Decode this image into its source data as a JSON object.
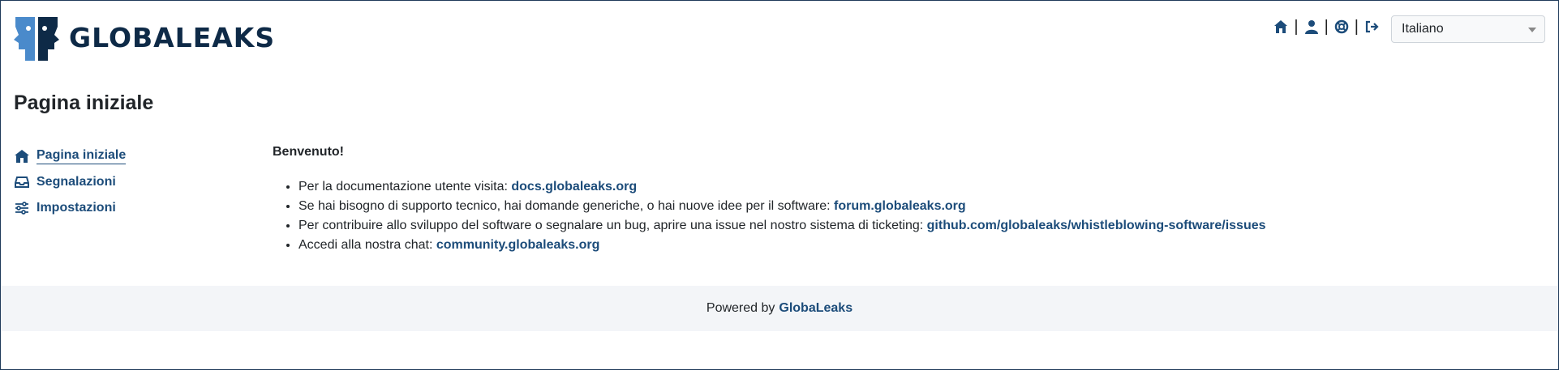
{
  "brand": {
    "name": "GLOBALEAKS",
    "logo_icon": "globaleaks-faces-logo",
    "colors": {
      "primary": "#1c4c7a",
      "dark": "#0e2a47",
      "light_blue": "#4a8acb"
    }
  },
  "header": {
    "icons": [
      "home-icon",
      "user-icon",
      "support-icon",
      "logout-icon"
    ],
    "separator": "|",
    "language": {
      "selected": "Italiano"
    }
  },
  "page": {
    "title": "Pagina iniziale"
  },
  "sidebar": {
    "items": [
      {
        "label": "Pagina iniziale",
        "icon": "home-icon",
        "active": true
      },
      {
        "label": "Segnalazioni",
        "icon": "inbox-icon",
        "active": false
      },
      {
        "label": "Impostazioni",
        "icon": "sliders-icon",
        "active": false
      }
    ]
  },
  "main": {
    "welcome": "Benvenuto!",
    "items": [
      {
        "text": "Per la documentazione utente visita: ",
        "link": "docs.globaleaks.org"
      },
      {
        "text": "Se hai bisogno di supporto tecnico, hai domande generiche, o hai nuove idee per il software: ",
        "link": "forum.globaleaks.org"
      },
      {
        "text": "Per contribuire allo sviluppo del software o segnalare un bug, aprire una issue nel nostro sistema di ticketing: ",
        "link": "github.com/globaleaks/whistleblowing-software/issues"
      },
      {
        "text": "Accedi alla nostra chat: ",
        "link": "community.globaleaks.org"
      }
    ]
  },
  "footer": {
    "text": "Powered by",
    "link": "GlobaLeaks"
  }
}
